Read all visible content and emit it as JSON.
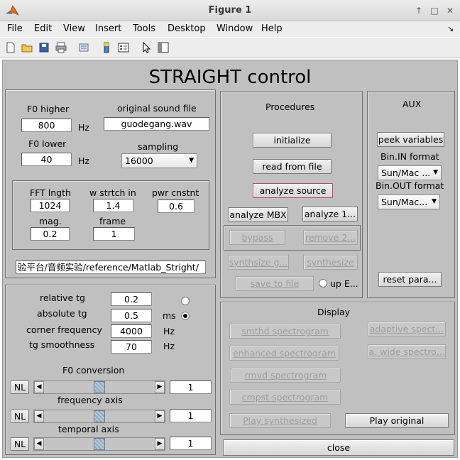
{
  "window": {
    "title": "Figure 1"
  },
  "menu": [
    "File",
    "Edit",
    "View",
    "Insert",
    "Tools",
    "Desktop",
    "Window",
    "Help"
  ],
  "menu_mnemonics": [
    "F",
    "E",
    "V",
    "I",
    "T",
    "D",
    "W",
    "H"
  ],
  "main_title": "STRAIGHT control",
  "f0": {
    "higher_label": "F0 higher",
    "higher_value": "800",
    "lower_label": "F0 lower",
    "lower_value": "40",
    "hz1": "Hz",
    "hz2": "Hz"
  },
  "sound": {
    "label": "original sound file",
    "value": "guodegang.wav",
    "sampling_label": "sampling",
    "sampling_value": "16000"
  },
  "analysis": {
    "fft_label": "FFT lngth",
    "fft_value": "1024",
    "stretch_label": "w strtch in",
    "stretch_value": "1.4",
    "power_label": "pwr cnstnt",
    "power_value": "0.6",
    "mag_label": "mag.",
    "mag_value": "0.2",
    "frame_label": "frame",
    "frame_value": "1"
  },
  "path_value": "验平台/音频实验/reference/Matlab_Stright/",
  "procedures": {
    "title": "Procedures",
    "initialize": "initialize",
    "read_from_file": "read from file",
    "analyze_source": "analyze source",
    "analyze_mbx": "analyze MBX",
    "analyze_1": "analyze 1...",
    "bypass": "bypass",
    "remove_2": "remove 2...",
    "synthsize_g": "synthsize g...",
    "synthesize": "synthesize",
    "save_to_file": "save to file",
    "up_e": "up E..."
  },
  "aux": {
    "title": "AUX",
    "peek": "peek variables",
    "bin_in_label": "Bin.IN format",
    "bin_in_value": "Sun/Mac ...",
    "bin_out_label": "Bin.OUT format",
    "bin_out_value": "Sun/Mac...",
    "reset": "reset para..."
  },
  "tg": {
    "relative_label": "relative tg",
    "relative_value": "0.2",
    "absolute_label": "absolute tg",
    "absolute_value": "0.5",
    "absolute_unit": "ms",
    "corner_label": "corner frequency",
    "corner_value": "4000",
    "corner_unit": "Hz",
    "smooth_label": "tg smoothness",
    "smooth_value": "70",
    "smooth_unit": "Hz",
    "relative_selected": false,
    "absolute_selected": true
  },
  "conversion": {
    "title": "F0 conversion",
    "nl": "NL",
    "f0_value": "1",
    "freq_label": "frequency axis",
    "freq_value": "1",
    "temporal_label": "temporal axis",
    "temporal_value": "1",
    "slider_levels": [
      0.5,
      0.5,
      0.5
    ]
  },
  "display": {
    "title": "Display",
    "smthd": "smthd spectrogram",
    "adaptive": "adaptive spect...",
    "enhanced": "enhanced spectrogram",
    "wide": "a. wide spectro...",
    "rmvd": "rmvd spectrogram",
    "cmpst": "cmpst spectrogram",
    "play_synth": "Play synthesized",
    "play_orig": "Play original"
  },
  "close": "close",
  "icons": {
    "app": "matlab-logo-icon",
    "toolbar": [
      "new-figure-icon",
      "open-file-icon",
      "save-icon",
      "print-icon",
      "link-icon",
      "insert-colorbar-icon",
      "insert-legend-icon",
      "pointer-icon",
      "property-editor-icon"
    ]
  }
}
